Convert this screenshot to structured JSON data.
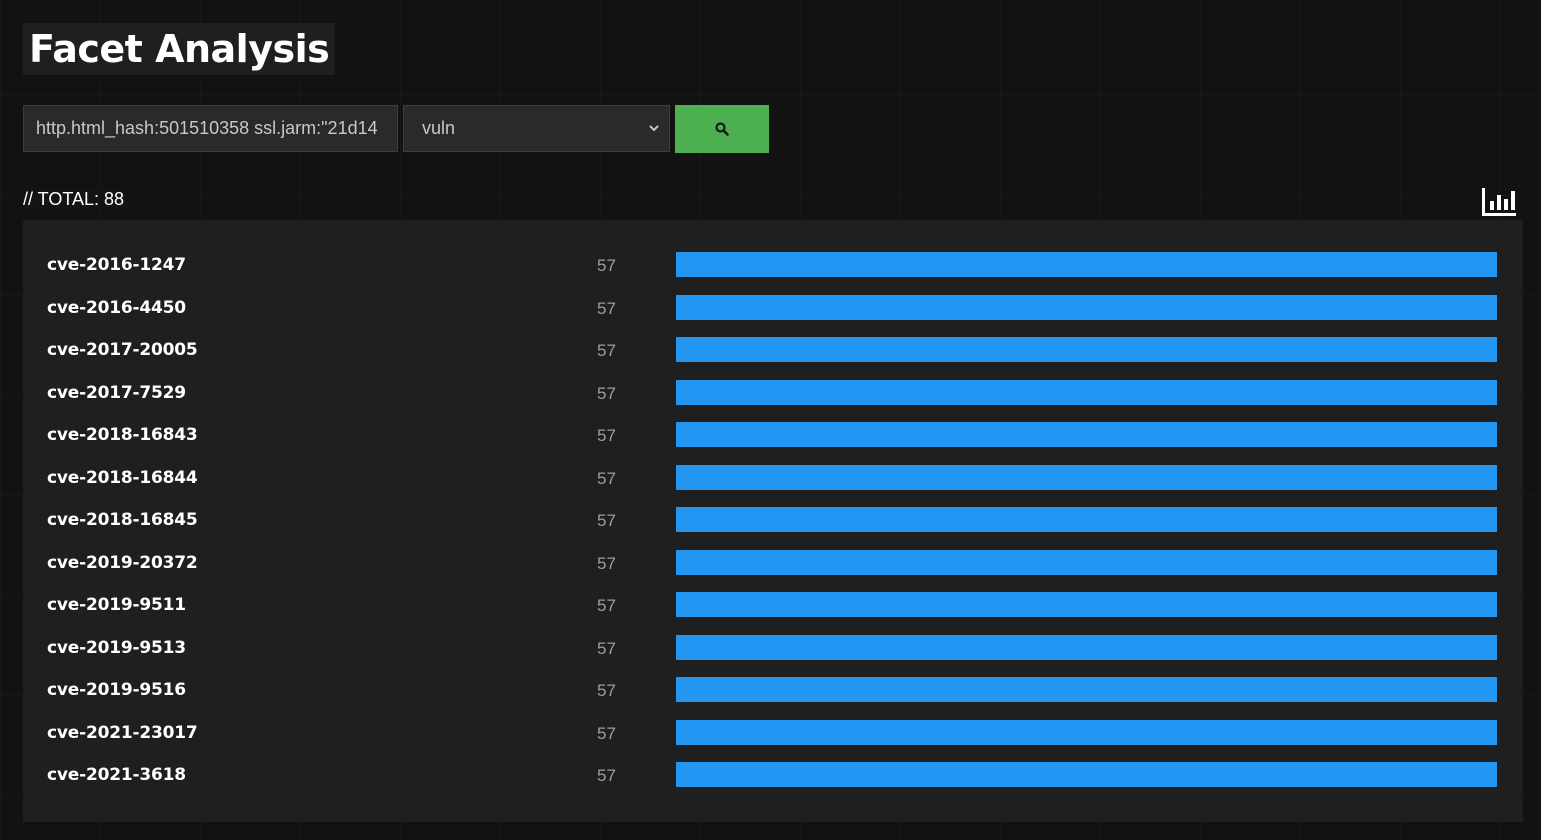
{
  "header": {
    "title": "Facet Analysis"
  },
  "search": {
    "query_value": "http.html_hash:501510358 ssl.jarm:\"21d14",
    "facet_selected": "vuln",
    "submit_icon": "search-icon"
  },
  "summary": {
    "total_label": "// TOTAL: 88",
    "chart_icon": "bar-chart-icon"
  },
  "colors": {
    "bar": "#2196f3",
    "button": "#4caf50",
    "panel": "#1f1f1f"
  },
  "facets": [
    {
      "label": "cve-2016-1247",
      "count": "57",
      "share": 1.0
    },
    {
      "label": "cve-2016-4450",
      "count": "57",
      "share": 1.0
    },
    {
      "label": "cve-2017-20005",
      "count": "57",
      "share": 1.0
    },
    {
      "label": "cve-2017-7529",
      "count": "57",
      "share": 1.0
    },
    {
      "label": "cve-2018-16843",
      "count": "57",
      "share": 1.0
    },
    {
      "label": "cve-2018-16844",
      "count": "57",
      "share": 1.0
    },
    {
      "label": "cve-2018-16845",
      "count": "57",
      "share": 1.0
    },
    {
      "label": "cve-2019-20372",
      "count": "57",
      "share": 1.0
    },
    {
      "label": "cve-2019-9511",
      "count": "57",
      "share": 1.0
    },
    {
      "label": "cve-2019-9513",
      "count": "57",
      "share": 1.0
    },
    {
      "label": "cve-2019-9516",
      "count": "57",
      "share": 1.0
    },
    {
      "label": "cve-2021-23017",
      "count": "57",
      "share": 1.0
    },
    {
      "label": "cve-2021-3618",
      "count": "57",
      "share": 1.0
    }
  ]
}
